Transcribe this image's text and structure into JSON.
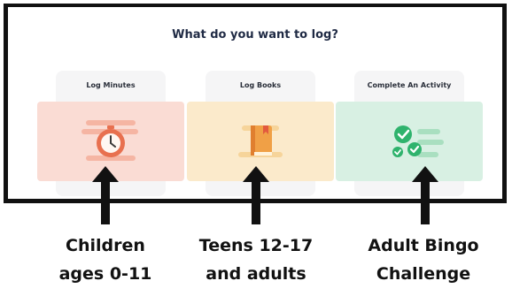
{
  "prompt_title": "What do you want to log?",
  "cards": [
    {
      "label": "Log Minutes",
      "icon": "clock-icon",
      "color": "#fadcd4"
    },
    {
      "label": "Log Books",
      "icon": "book-icon",
      "color": "#fbeacb"
    },
    {
      "label": "Complete An Activity",
      "icon": "checklist-icon",
      "color": "#d8f0e3"
    }
  ],
  "captions": [
    {
      "line1": "Children",
      "line2": "ages 0-11"
    },
    {
      "line1": "Teens 12-17",
      "line2": "and adults"
    },
    {
      "line1": "Adult Bingo",
      "line2": "Challenge"
    }
  ],
  "colors": {
    "frame": "#111111",
    "clock": "#e8704f",
    "book": "#f0a046",
    "check": "#2fb36d"
  }
}
